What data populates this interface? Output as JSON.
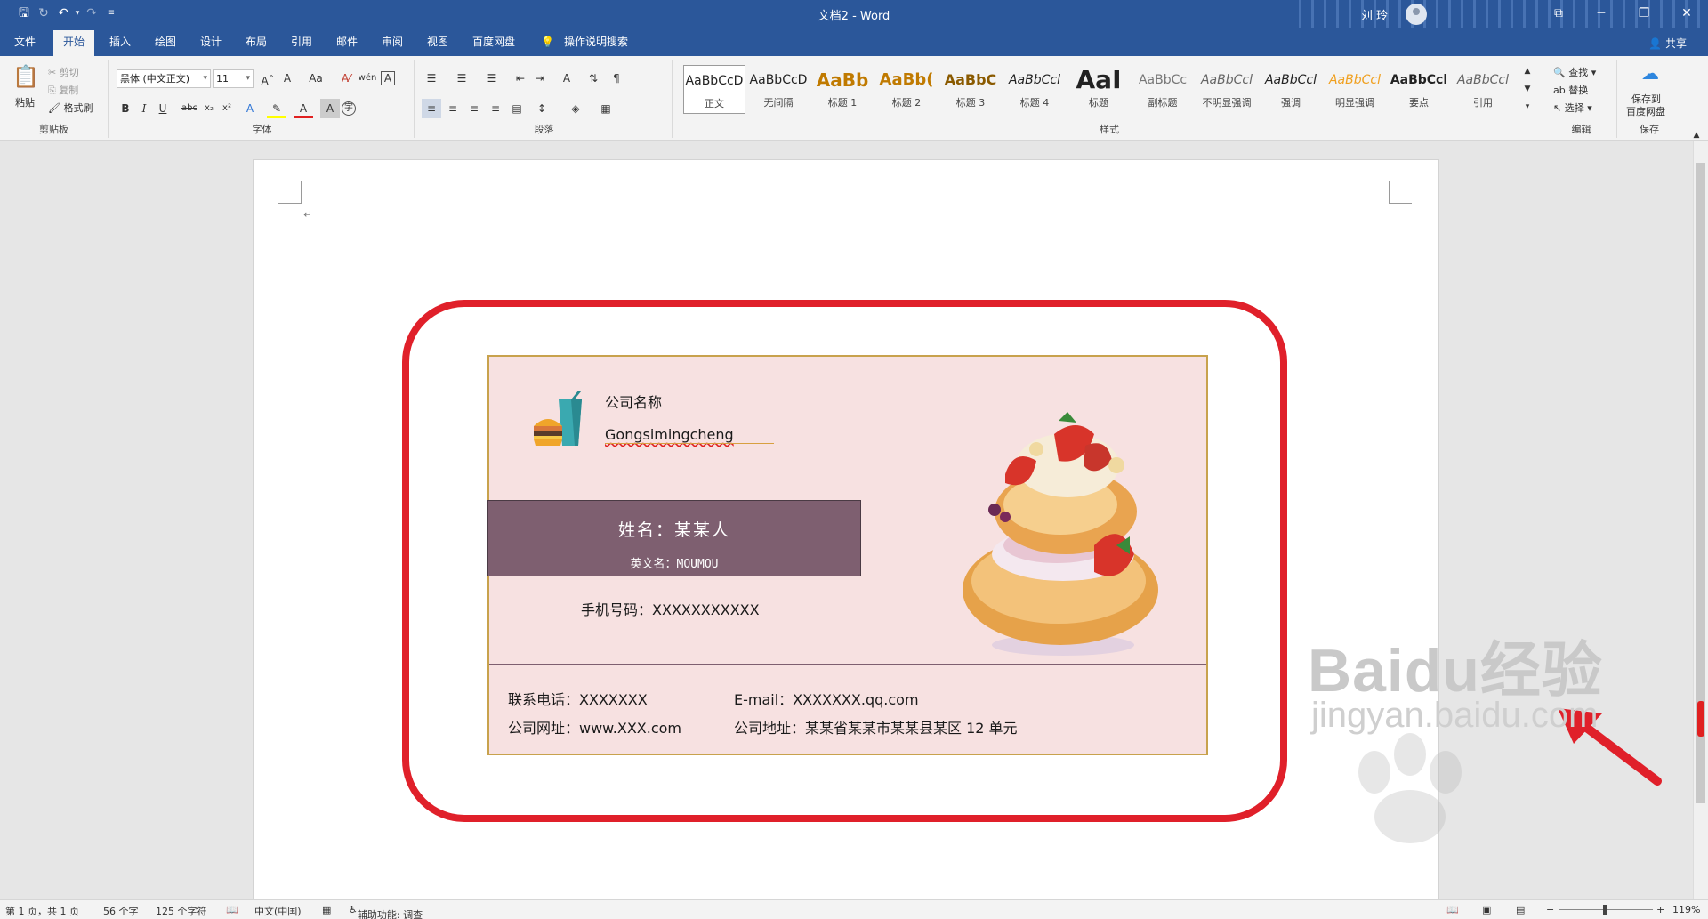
{
  "titlebar": {
    "doc_title": "文档2  -  Word",
    "user": "刘 玲"
  },
  "tabs": [
    "文件",
    "开始",
    "插入",
    "绘图",
    "设计",
    "布局",
    "引用",
    "邮件",
    "审阅",
    "视图",
    "百度网盘",
    "操作说明搜索"
  ],
  "share_label": "共享",
  "ribbon": {
    "clipboard": {
      "paste": "粘贴",
      "cut": "剪切",
      "copy": "复制",
      "format_painter": "格式刷",
      "label": "剪贴板"
    },
    "font": {
      "family": "黑体 (中文正文)",
      "size": "11",
      "label": "字体",
      "case": "Aa"
    },
    "paragraph": {
      "label": "段落"
    },
    "styles": {
      "label": "样式",
      "items": [
        {
          "sample": "AaBbCcD",
          "name": "正文"
        },
        {
          "sample": "AaBbCcD",
          "name": "无间隔"
        },
        {
          "sample": "AaBb",
          "name": "标题 1"
        },
        {
          "sample": "AaBb(",
          "name": "标题 2"
        },
        {
          "sample": "AaBbC",
          "name": "标题 3"
        },
        {
          "sample": "AaBbCcl",
          "name": "标题 4"
        },
        {
          "sample": "AaI",
          "name": "标题"
        },
        {
          "sample": "AaBbCc",
          "name": "副标题"
        },
        {
          "sample": "AaBbCcl",
          "name": "不明显强调"
        },
        {
          "sample": "AaBbCcl",
          "name": "强调"
        },
        {
          "sample": "AaBbCcl",
          "name": "明显强调"
        },
        {
          "sample": "AaBbCcl",
          "name": "要点"
        },
        {
          "sample": "AaBbCcl",
          "name": "引用"
        }
      ]
    },
    "editing": {
      "find": "查找",
      "replace": "替换",
      "select": "选择",
      "label": "编辑"
    },
    "save": {
      "line1": "保存到",
      "line2": "百度网盘",
      "label": "保存"
    }
  },
  "card": {
    "company_name": "公司名称",
    "company_en": "Gongsimingcheng",
    "name": "姓名：某某人",
    "en_name": "英文名：MOUMOU",
    "mobile": "手机号码：XXXXXXXXXXX",
    "phone": "联系电话：XXXXXXX",
    "email": "E-mail：XXXXXXX.qq.com",
    "website": "公司网址：www.XXX.com",
    "address": "公司地址：某某省某某市某某县某区 12 单元"
  },
  "watermark": {
    "brand": "Baidu经验",
    "url": "jingyan.baidu.com"
  },
  "status": {
    "page": "第 1 页，共 1 页",
    "words": "56 个字",
    "chars": "125 个字符",
    "lang": "中文(中国)",
    "accessibility": "辅助功能: 调查",
    "zoom": "119%"
  },
  "colors": {
    "accent": "#2b579a",
    "highlight": "#e0202a",
    "card_bg": "#f7e1e1",
    "name_bar": "#7e5f70"
  }
}
